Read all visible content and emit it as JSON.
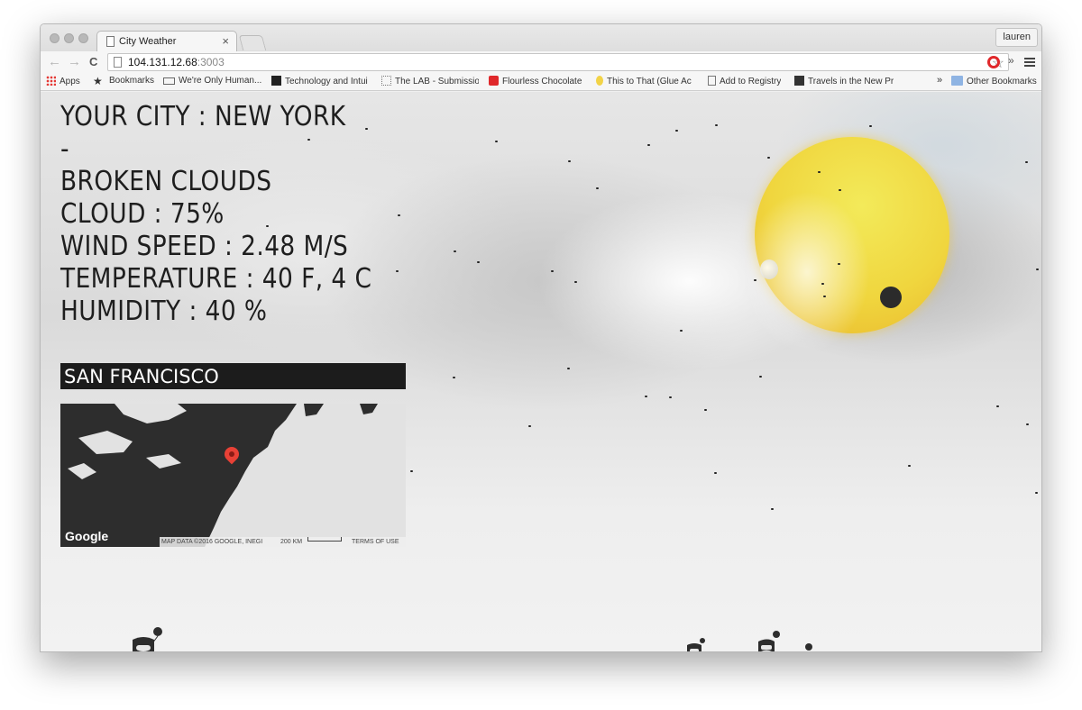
{
  "browser": {
    "tab_title": "City Weather",
    "tab_close": "×",
    "profile": "lauren",
    "url_host": "104.131.12.68",
    "url_port": ":3003",
    "back": "←",
    "forward": "→",
    "reload": "C",
    "star": "☆",
    "extensions_more": "»"
  },
  "bookmarks": {
    "items": [
      {
        "label": "Apps",
        "icon": "apps-icon"
      },
      {
        "label": "Bookmarks",
        "icon": "star-icon"
      },
      {
        "label": "We're Only Human...",
        "icon": "link-icon"
      },
      {
        "label": "Technology and Intui",
        "icon": "link-icon"
      },
      {
        "label": "The LAB - Submissio",
        "icon": "grid-icon"
      },
      {
        "label": "Flourless Chocolate",
        "icon": "e-icon"
      },
      {
        "label": "This to That (Glue Ac",
        "icon": "bulb-icon"
      },
      {
        "label": "Add to Registry",
        "icon": "page-icon"
      },
      {
        "label": "Travels in the New Pr",
        "icon": "image-icon"
      }
    ],
    "overflow": "»",
    "other": "Other Bookmarks"
  },
  "weather": {
    "city_line": "YOUR CITY : NEW YORK",
    "dash": "-",
    "description": "BROKEN CLOUDS",
    "cloud": "CLOUD : 75%",
    "wind": "WIND SPEED : 2.48 M/S",
    "temperature": "TEMPERATURE : 40 F, 4 C",
    "humidity": "HUMIDITY : 40 %"
  },
  "city_input": {
    "value": "SAN FRANCISCO"
  },
  "map": {
    "logo": "Google",
    "data": "MAP DATA ©2016 GOOGLE, INEGI",
    "scale": "200 KM",
    "terms": "TERMS OF USE"
  },
  "colors": {
    "sun": "#f0d63e",
    "text": "#1e1e1e",
    "input_bg": "#1c1c1c",
    "pin": "#e84136"
  }
}
